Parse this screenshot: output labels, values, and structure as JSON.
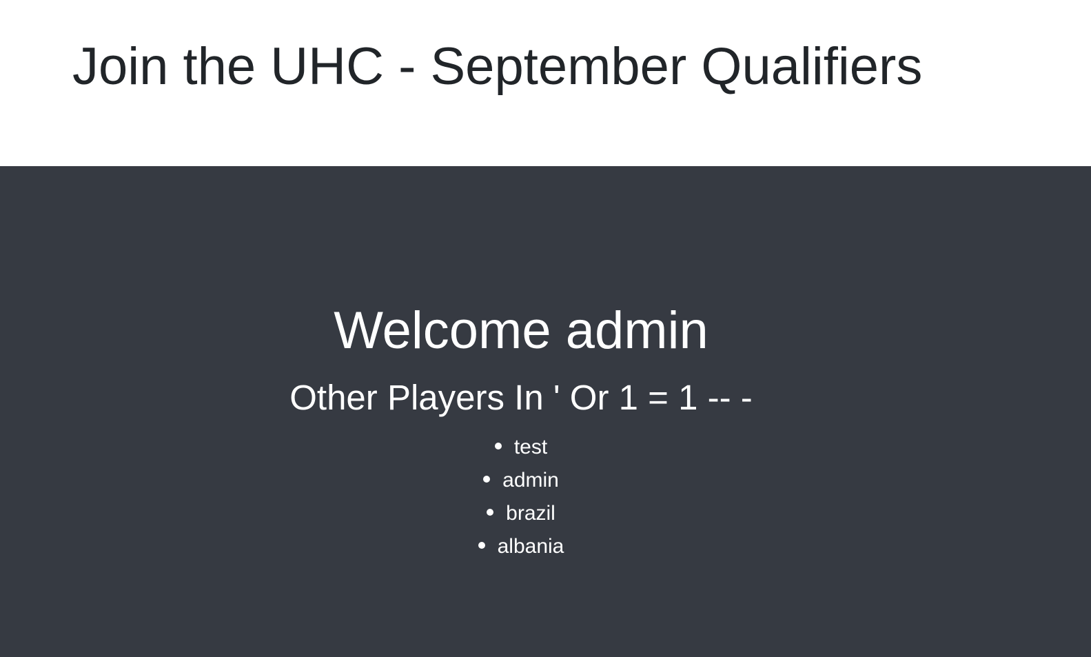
{
  "colors": {
    "header_bg": "#ffffff",
    "main_bg": "#363a42",
    "title_text": "#212529",
    "main_text": "#ffffff"
  },
  "header": {
    "title": "Join the UHC - September Qualifiers"
  },
  "main": {
    "welcome": "Welcome admin",
    "subheading": "Other Players In ' Or 1 = 1 -- -",
    "players": [
      "test",
      "admin",
      "brazil",
      "albania"
    ]
  }
}
